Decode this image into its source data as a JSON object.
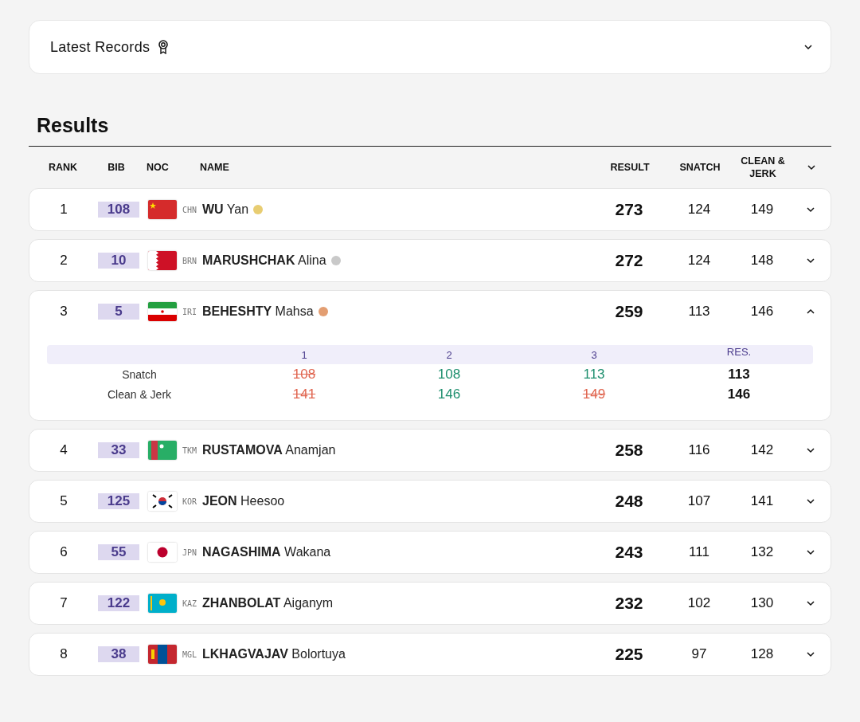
{
  "records": {
    "title": "Latest Records",
    "expanded": false
  },
  "results_title": "Results",
  "columns": {
    "rank": "RANK",
    "bib": "BIB",
    "noc": "NOC",
    "name": "NAME",
    "result": "RESULT",
    "snatch": "SNATCH",
    "clean_jerk": "CLEAN & JERK"
  },
  "rows": [
    {
      "rank": "1",
      "bib": "108",
      "noc": "CHN",
      "surname": "WU",
      "given": "Yan",
      "color": "#e8cd72",
      "result": "273",
      "snatch": "124",
      "clean_jerk": "149",
      "expanded": false
    },
    {
      "rank": "2",
      "bib": "10",
      "noc": "BRN",
      "surname": "MARUSHCHAK",
      "given": "Alina",
      "color": "#c9c9c9",
      "result": "272",
      "snatch": "124",
      "clean_jerk": "148",
      "expanded": false
    },
    {
      "rank": "3",
      "bib": "5",
      "noc": "IRI",
      "surname": "BEHESHTY",
      "given": "Mahsa",
      "color": "#e39e72",
      "result": "259",
      "snatch": "113",
      "clean_jerk": "146",
      "expanded": true,
      "detail": {
        "headers": [
          "1",
          "2",
          "3",
          "RES."
        ],
        "lifts": [
          {
            "label": "Snatch",
            "attempts": [
              {
                "value": "108",
                "good": false
              },
              {
                "value": "108",
                "good": true
              },
              {
                "value": "113",
                "good": true
              }
            ],
            "res": "113"
          },
          {
            "label": "Clean & Jerk",
            "attempts": [
              {
                "value": "141",
                "good": false
              },
              {
                "value": "146",
                "good": true
              },
              {
                "value": "149",
                "good": false
              }
            ],
            "res": "146"
          }
        ]
      }
    },
    {
      "rank": "4",
      "bib": "33",
      "noc": "TKM",
      "surname": "RUSTAMOVA",
      "given": "Anamjan",
      "result": "258",
      "snatch": "116",
      "clean_jerk": "142",
      "expanded": false
    },
    {
      "rank": "5",
      "bib": "125",
      "noc": "KOR",
      "surname": "JEON",
      "given": "Heesoo",
      "result": "248",
      "snatch": "107",
      "clean_jerk": "141",
      "expanded": false
    },
    {
      "rank": "6",
      "bib": "55",
      "noc": "JPN",
      "surname": "NAGASHIMA",
      "given": "Wakana",
      "result": "243",
      "snatch": "111",
      "clean_jerk": "132",
      "expanded": false
    },
    {
      "rank": "7",
      "bib": "122",
      "noc": "KAZ",
      "surname": "ZHANBOLAT",
      "given": "Aiganym",
      "result": "232",
      "snatch": "102",
      "clean_jerk": "130",
      "expanded": false
    },
    {
      "rank": "8",
      "bib": "38",
      "noc": "MGL",
      "surname": "LKHAGVAJAV",
      "given": "Bolortuya",
      "result": "225",
      "snatch": "97",
      "clean_jerk": "128",
      "expanded": false
    }
  ]
}
